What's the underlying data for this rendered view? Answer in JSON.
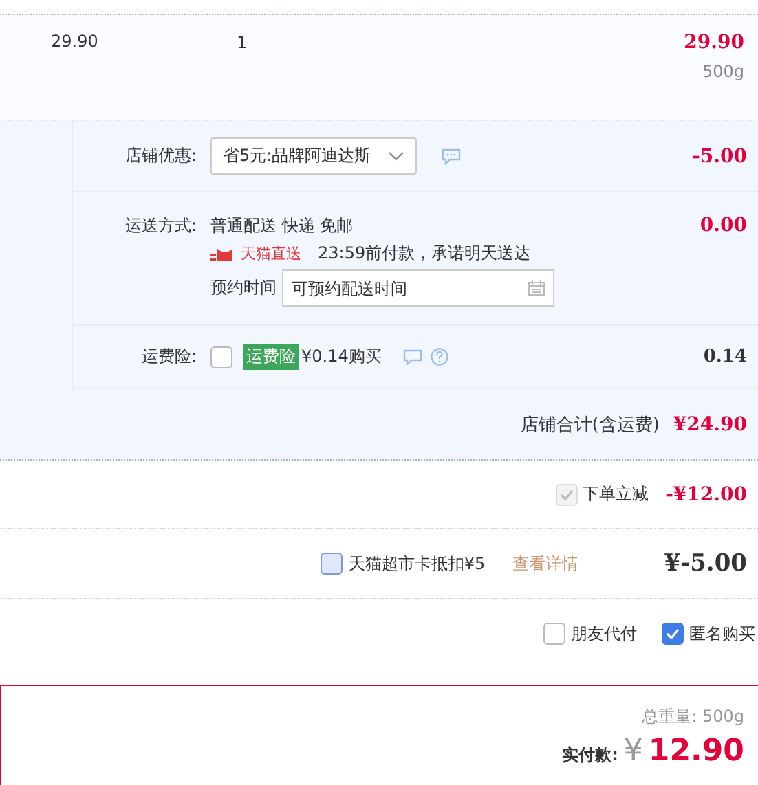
{
  "item": {
    "price": "29.90",
    "quantity": "1",
    "subtotal": "29.90",
    "weight": "500g"
  },
  "shop": {
    "discount": {
      "label": "店铺优惠:",
      "value": "省5元:品牌阿迪达斯",
      "amount": "-5.00"
    },
    "shipping": {
      "label": "运送方式:",
      "method": "普通配送 快递 免邮",
      "badge": "天猫直送",
      "promise": "23:59前付款，承诺明天送达",
      "schedule_label": "预约时间",
      "schedule_placeholder": "可预约配送时间",
      "amount": "0.00"
    },
    "insurance": {
      "label": "运费险:",
      "checked": false,
      "tag": "运费险",
      "price": "¥0.14购买",
      "amount": "0.14"
    },
    "total": {
      "label": "店铺合计(含运费)",
      "amount": "¥24.90"
    }
  },
  "instant_discount": {
    "label": "下单立减",
    "checked": true,
    "disabled": true,
    "amount": "-¥12.00"
  },
  "card": {
    "label": "天猫超市卡抵扣¥5",
    "checked": false,
    "link": "查看详情",
    "amount": "¥-5.00"
  },
  "options": [
    {
      "label": "朋友代付",
      "checked": false
    },
    {
      "label": "匿名购买",
      "checked": true
    }
  ],
  "summary": {
    "weight_label": "总重量:",
    "weight": "500g",
    "pay_label": "实付款:",
    "currency": "¥",
    "pay": "12.90"
  }
}
